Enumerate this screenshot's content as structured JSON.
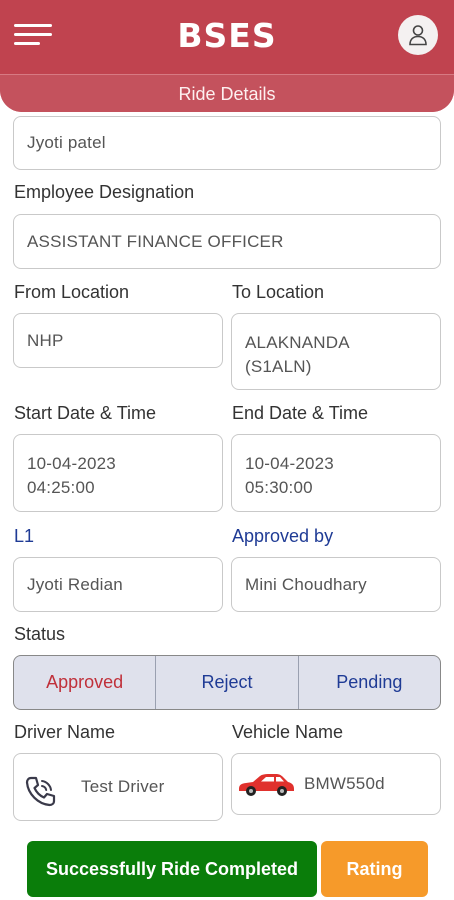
{
  "app": {
    "logo": "BSES",
    "page_title": "Ride Details"
  },
  "form": {
    "employee_name_value": "Jyoti patel",
    "designation_label": "Employee Designation",
    "designation_value": "ASSISTANT FINANCE OFFICER",
    "from_label": "From Location",
    "from_value": "NHP",
    "to_label": "To Location",
    "to_value_line1": "ALAKNANDA",
    "to_value_line2": "(S1ALN)",
    "start_label": "Start Date & Time",
    "start_date": "10-04-2023",
    "start_time": "04:25:00",
    "end_label": "End Date & Time",
    "end_date": "10-04-2023",
    "end_time": "05:30:00",
    "l1_label": "L1",
    "l1_value": "Jyoti Redian",
    "approved_by_label": "Approved by",
    "approved_by_value": "Mini Choudhary",
    "status_label": "Status",
    "status_options": [
      "Approved",
      "Reject",
      "Pending"
    ],
    "driver_label": "Driver Name",
    "driver_value": "Test Driver",
    "vehicle_label": "Vehicle Name",
    "vehicle_value": "BMW550d"
  },
  "actions": {
    "complete_label": "Successfully Ride Completed",
    "rating_label": "Rating"
  },
  "colors": {
    "header": "#c0434f",
    "accent_blue": "#1f3b95",
    "approved_red": "#c0303a",
    "complete_green": "#0a7d0a",
    "rating_orange": "#f69a2a"
  },
  "icons": {
    "menu": "hamburger-menu-icon",
    "profile": "user-profile-icon",
    "driver": "phone-icon",
    "vehicle": "car-icon"
  }
}
